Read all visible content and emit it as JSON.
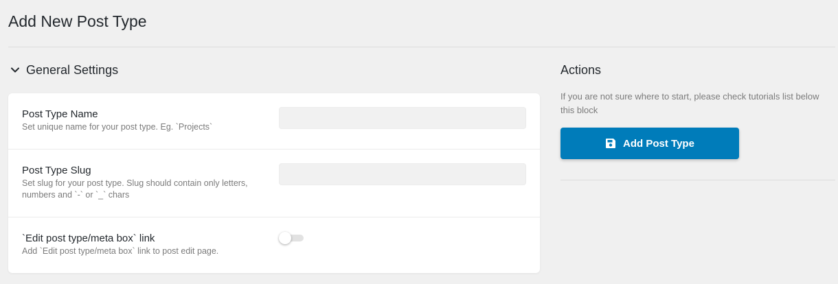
{
  "page": {
    "title": "Add New Post Type"
  },
  "general_settings": {
    "title": "General Settings",
    "fields": [
      {
        "label": "Post Type Name",
        "description": "Set unique name for your post type. Eg. `Projects`",
        "value": "",
        "placeholder": ""
      },
      {
        "label": "Post Type Slug",
        "description": "Set slug for your post type. Slug should contain only letters, numbers and `-` or `_` chars",
        "value": "",
        "placeholder": ""
      },
      {
        "label": "`Edit post type/meta box` link",
        "description": "Add `Edit post type/meta box` link to post edit page.",
        "enabled": false
      }
    ]
  },
  "actions": {
    "title": "Actions",
    "description": "If you are not sure where to start, please check tutorials list below this block",
    "add_button_label": "Add Post Type",
    "add_button_icon": "save-icon",
    "accent_color": "#007cba"
  }
}
